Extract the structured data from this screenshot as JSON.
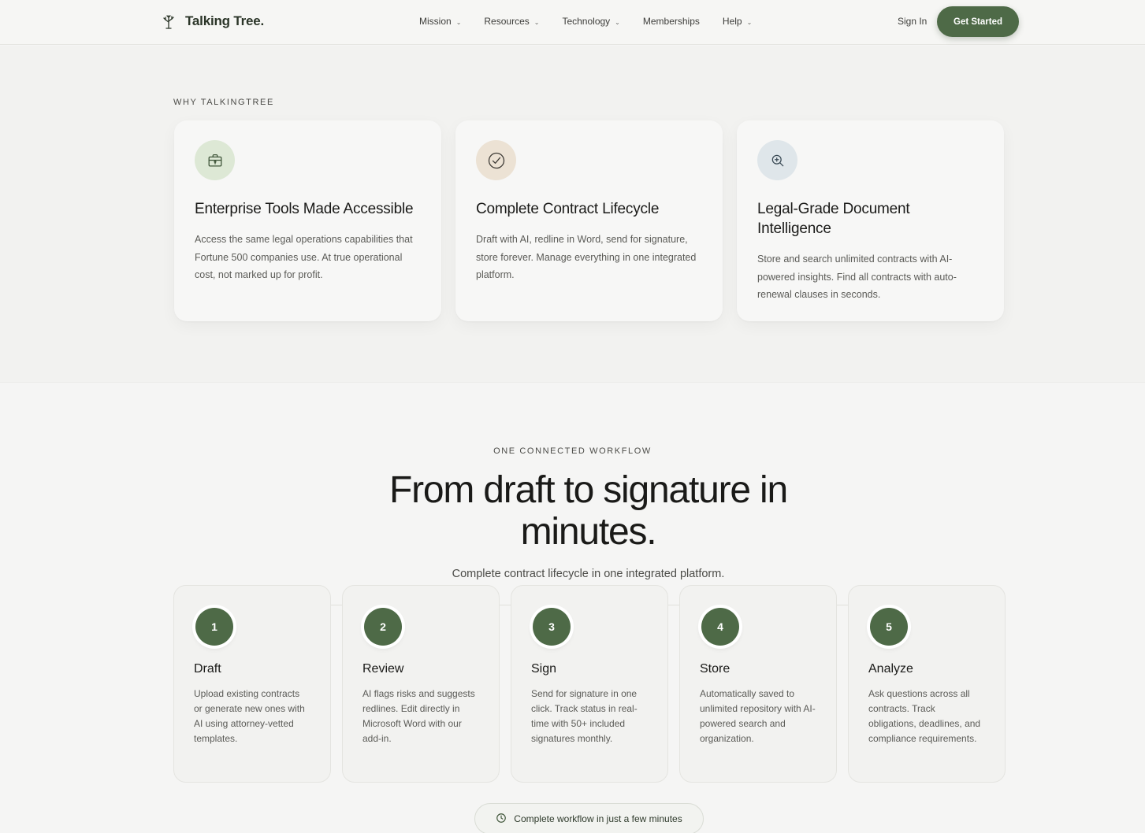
{
  "nav": {
    "brand": "Talking Tree.",
    "items": [
      {
        "label": "Mission",
        "dropdown": true
      },
      {
        "label": "Resources",
        "dropdown": true
      },
      {
        "label": "Technology",
        "dropdown": true
      },
      {
        "label": "Memberships",
        "dropdown": false
      },
      {
        "label": "Help",
        "dropdown": true
      }
    ],
    "sign_in": "Sign In",
    "cta": "Get Started"
  },
  "why": {
    "eyebrow": "WHY TALKINGTREE",
    "features": [
      {
        "icon": "briefcase-lock-icon",
        "title": "Enterprise Tools Made Accessible",
        "body": "Access the same legal operations capabilities that Fortune 500 companies use. At true operational cost, not marked up for profit."
      },
      {
        "icon": "check-circle-icon",
        "title": "Complete Contract Lifecycle",
        "body": "Draft with AI, redline in Word, send for signature, store forever. Manage everything in one integrated platform."
      },
      {
        "icon": "search-icon",
        "title": "Legal-Grade Document Intelligence",
        "body": "Store and search unlimited contracts with AI-powered insights. Find all contracts with auto-renewal clauses in seconds."
      }
    ]
  },
  "workflow": {
    "eyebrow": "ONE CONNECTED WORKFLOW",
    "title_line1": "From draft to signature in",
    "title_line2": "minutes.",
    "subtitle": "Complete contract lifecycle in one integrated platform.",
    "steps": [
      {
        "num": "1",
        "title": "Draft",
        "body": "Upload existing contracts or generate new ones with AI using attorney-vetted templates."
      },
      {
        "num": "2",
        "title": "Review",
        "body": "AI flags risks and suggests redlines. Edit directly in Microsoft Word with our add-in."
      },
      {
        "num": "3",
        "title": "Sign",
        "body": "Send for signature in one click. Track status in real-time with 50+ included signatures monthly."
      },
      {
        "num": "4",
        "title": "Store",
        "body": "Automatically saved to unlimited repository with AI-powered search and organization."
      },
      {
        "num": "5",
        "title": "Analyze",
        "body": "Ask questions across all contracts. Track obligations, deadlines, and compliance requirements."
      }
    ],
    "pill": "Complete workflow in just a few minutes"
  },
  "colors": {
    "accent": "#4e6a47",
    "background": "#f5f5f4",
    "icon_bg_green": "#dde8d5",
    "icon_bg_beige": "#ece2d4",
    "icon_bg_blue": "#dfe6ea"
  }
}
